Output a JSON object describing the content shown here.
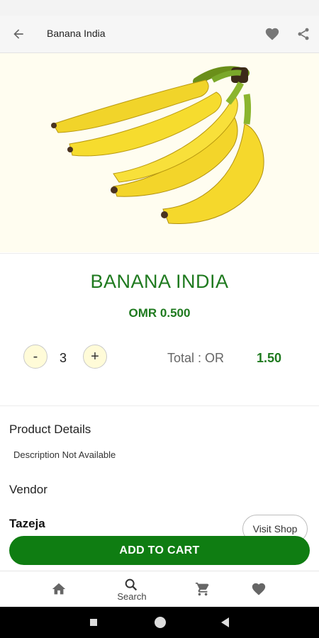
{
  "header": {
    "title": "Banana India"
  },
  "product": {
    "name": "BANANA INDIA",
    "price": "OMR 0.500",
    "quantity": "3",
    "total_label": "Total : OR",
    "total_value": "1.50"
  },
  "details": {
    "product_details_label": "Product Details",
    "description": "Description Not Available",
    "vendor_label": "Vendor",
    "vendor_name": "Tazeja",
    "visit_shop_label": "Visit Shop"
  },
  "actions": {
    "add_to_cart": "ADD TO CART",
    "minus": "-",
    "plus": "+"
  },
  "bottom_nav": {
    "items": [
      {
        "icon": "home-icon",
        "label": ""
      },
      {
        "icon": "search-icon",
        "label": "Search"
      },
      {
        "icon": "cart-icon",
        "label": ""
      },
      {
        "icon": "heart-icon",
        "label": ""
      }
    ]
  },
  "colors": {
    "brand_green": "#1f7a1f",
    "button_green": "#0f7d12",
    "qty_button_bg": "#fffbd8"
  }
}
